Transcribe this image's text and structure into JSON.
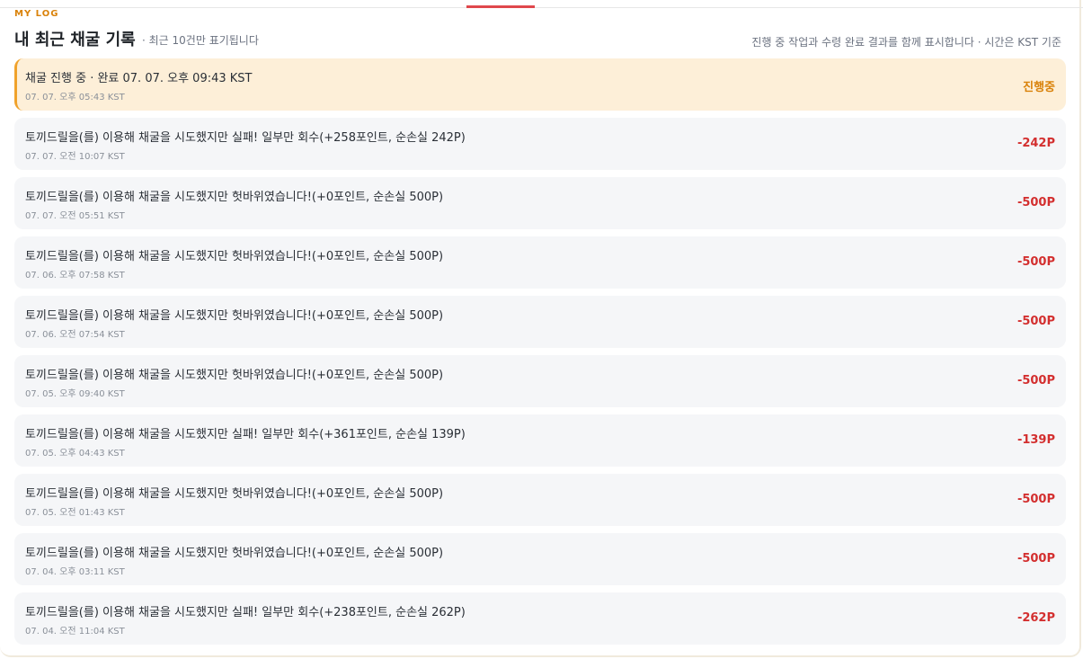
{
  "header": {
    "eyebrow": "MY LOG",
    "title": "내 최근 채굴 기록",
    "subtitle": "· 최근 10건만 표기됩니다",
    "note": "진행 중 작업과 수령 완료 결과를 함께 표시합니다 · 시간은 KST 기준"
  },
  "logs": [
    {
      "message": "채굴 진행 중 · 완료 07. 07. 오후 09:43 KST",
      "time": "07. 07. 오후 05:43 KST",
      "amount": "진행중",
      "status": "in-progress"
    },
    {
      "message": "토끼드릴을(를) 이용해 채굴을 시도했지만 실패! 일부만 회수(+258포인트, 순손실 242P)",
      "time": "07. 07. 오전 10:07 KST",
      "amount": "-242P",
      "status": "loss"
    },
    {
      "message": "토끼드릴을(를) 이용해 채굴을 시도했지만 헛바위였습니다!(+0포인트, 순손실 500P)",
      "time": "07. 07. 오전 05:51 KST",
      "amount": "-500P",
      "status": "loss"
    },
    {
      "message": "토끼드릴을(를) 이용해 채굴을 시도했지만 헛바위였습니다!(+0포인트, 순손실 500P)",
      "time": "07. 06. 오후 07:58 KST",
      "amount": "-500P",
      "status": "loss"
    },
    {
      "message": "토끼드릴을(를) 이용해 채굴을 시도했지만 헛바위였습니다!(+0포인트, 순손실 500P)",
      "time": "07. 06. 오전 07:54 KST",
      "amount": "-500P",
      "status": "loss"
    },
    {
      "message": "토끼드릴을(를) 이용해 채굴을 시도했지만 헛바위였습니다!(+0포인트, 순손실 500P)",
      "time": "07. 05. 오후 09:40 KST",
      "amount": "-500P",
      "status": "loss"
    },
    {
      "message": "토끼드릴을(를) 이용해 채굴을 시도했지만 실패! 일부만 회수(+361포인트, 순손실 139P)",
      "time": "07. 05. 오후 04:43 KST",
      "amount": "-139P",
      "status": "loss"
    },
    {
      "message": "토끼드릴을(를) 이용해 채굴을 시도했지만 헛바위였습니다!(+0포인트, 순손실 500P)",
      "time": "07. 05. 오전 01:43 KST",
      "amount": "-500P",
      "status": "loss"
    },
    {
      "message": "토끼드릴을(를) 이용해 채굴을 시도했지만 헛바위였습니다!(+0포인트, 순손실 500P)",
      "time": "07. 04. 오후 03:11 KST",
      "amount": "-500P",
      "status": "loss"
    },
    {
      "message": "토끼드릴을(를) 이용해 채굴을 시도했지만 실패! 일부만 회수(+238포인트, 순손실 262P)",
      "time": "07. 04. 오전 11:04 KST",
      "amount": "-262P",
      "status": "loss"
    }
  ],
  "colors": {
    "accent": "#d9820a",
    "loss": "#d32f2f",
    "progress_bg": "#fdefd8",
    "progress_border": "#f0a22b",
    "tab_indicator": "#e0474c"
  }
}
